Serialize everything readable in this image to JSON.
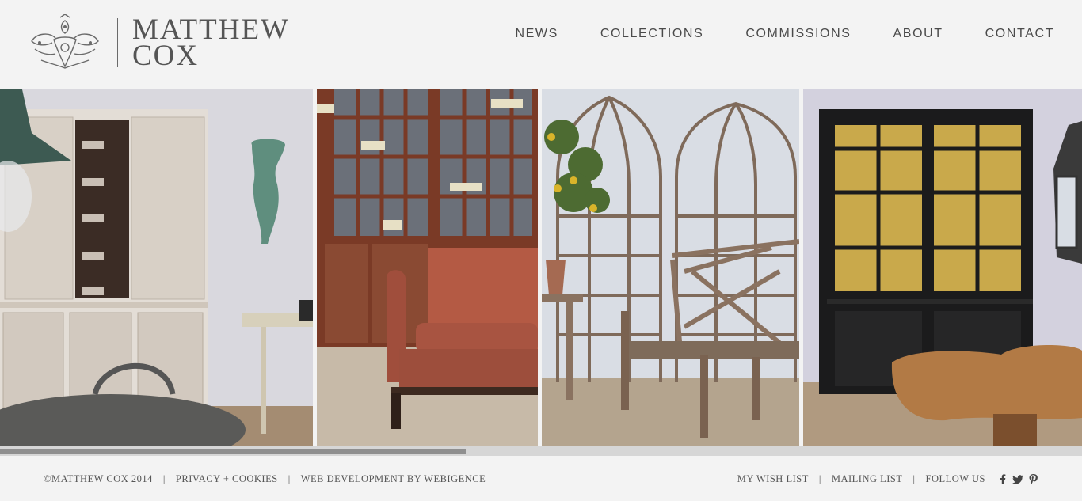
{
  "brand": {
    "line1": "MATTHEW",
    "line2": "COX"
  },
  "nav": [
    {
      "label": "NEWS"
    },
    {
      "label": "COLLECTIONS"
    },
    {
      "label": "COMMISSIONS"
    },
    {
      "label": "ABOUT"
    },
    {
      "label": "CONTACT"
    }
  ],
  "gallery": [
    {
      "subject": "distressed painted cupboard with verdigris sconce"
    },
    {
      "subject": "glazed mahogany bookcase with leather armchair"
    },
    {
      "subject": "gothic iron trellis panels with teak garden bench"
    },
    {
      "subject": "ebonised glazed cabinet with burr wood table"
    }
  ],
  "footer": {
    "copyright": "©MATTHEW COX 2014",
    "privacy": "PRIVACY + COOKIES",
    "webdev": "WEB DEVELOPMENT BY WEBIGENCE",
    "wishlist": "MY WISH LIST",
    "mailing": "MAILING LIST",
    "follow": "FOLLOW US"
  },
  "social_icons": [
    "facebook-icon",
    "twitter-icon",
    "pinterest-icon"
  ],
  "colors": {
    "background": "#f3f3f3",
    "text": "#4a4a4a",
    "scroll_track": "#d6d6d6",
    "scroll_thumb": "#8f8f8f"
  }
}
